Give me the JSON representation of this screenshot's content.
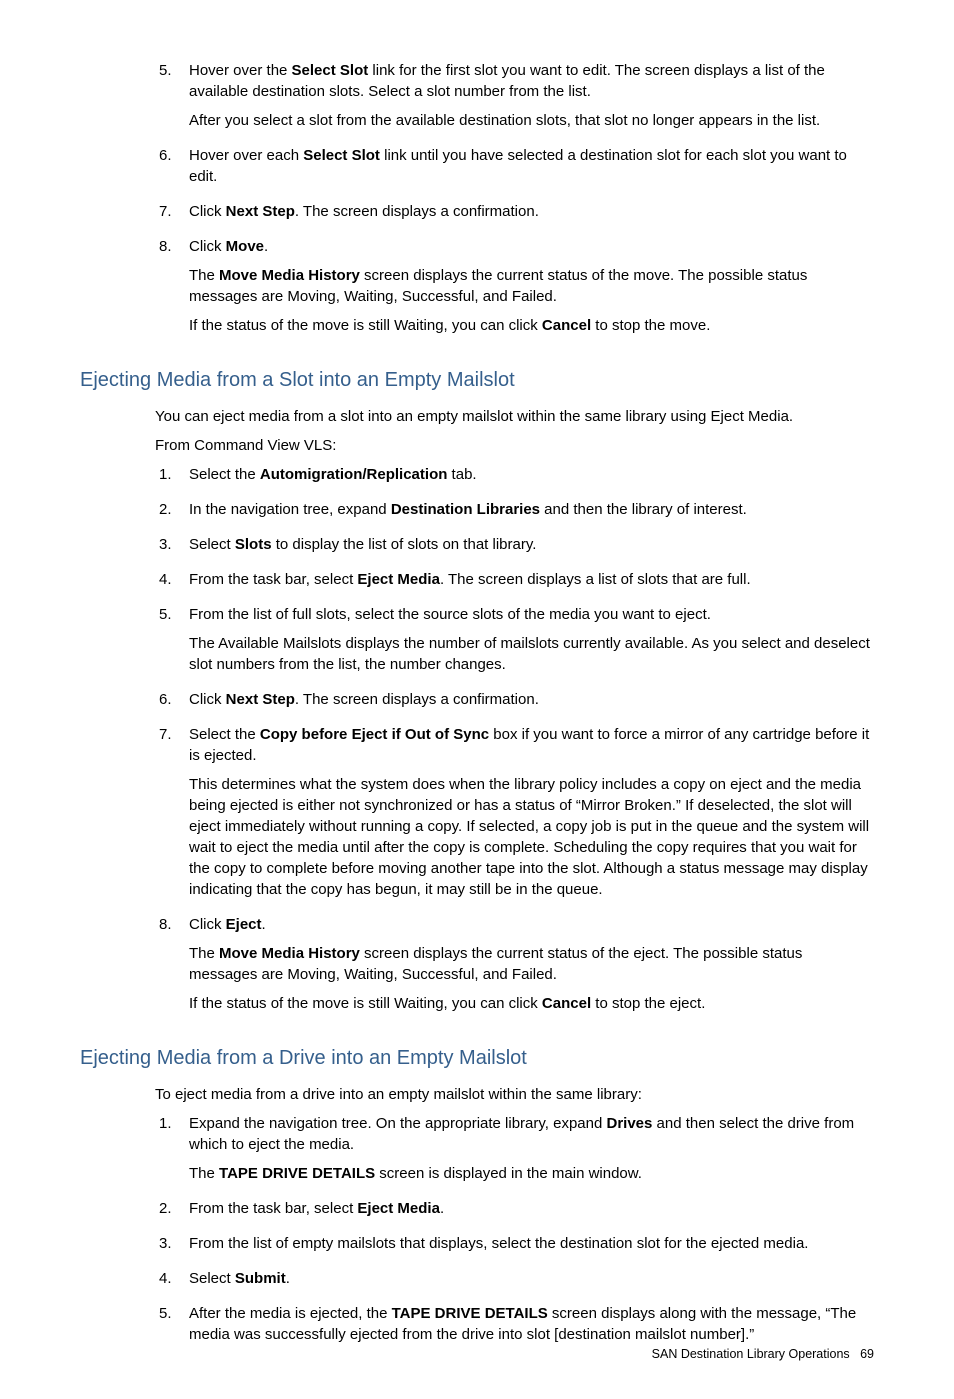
{
  "s0": {
    "items": [
      {
        "num": "5.",
        "paras": [
          [
            {
              "t": "Hover over the "
            },
            {
              "t": "Select Slot",
              "b": true
            },
            {
              "t": " link for the first slot you want to edit. The screen displays a list of the available destination slots. Select a slot number from the list."
            }
          ],
          [
            {
              "t": "After you select a slot from the available destination slots, that slot no longer appears in the list."
            }
          ]
        ]
      },
      {
        "num": "6.",
        "paras": [
          [
            {
              "t": "Hover over each "
            },
            {
              "t": "Select Slot",
              "b": true
            },
            {
              "t": " link until you have selected a destination slot for each slot you want to edit."
            }
          ]
        ]
      },
      {
        "num": "7.",
        "paras": [
          [
            {
              "t": "Click "
            },
            {
              "t": "Next Step",
              "b": true
            },
            {
              "t": ". The screen displays a confirmation."
            }
          ]
        ]
      },
      {
        "num": "8.",
        "paras": [
          [
            {
              "t": "Click "
            },
            {
              "t": "Move",
              "b": true
            },
            {
              "t": "."
            }
          ],
          [
            {
              "t": "The "
            },
            {
              "t": "Move Media History",
              "b": true
            },
            {
              "t": " screen displays the current status of the move. The possible status messages are Moving, Waiting, Successful, and Failed."
            }
          ],
          [
            {
              "t": "If the status of the move is still Waiting, you can click "
            },
            {
              "t": "Cancel",
              "b": true
            },
            {
              "t": " to stop the move."
            }
          ]
        ]
      }
    ]
  },
  "s1": {
    "heading": "Ejecting Media from a Slot into an Empty Mailslot",
    "intro": [
      "You can eject media from a slot into an empty mailslot within the same library using Eject Media.",
      "From Command View VLS:"
    ],
    "items": [
      {
        "num": "1.",
        "paras": [
          [
            {
              "t": "Select the "
            },
            {
              "t": "Automigration/Replication",
              "b": true
            },
            {
              "t": " tab."
            }
          ]
        ]
      },
      {
        "num": "2.",
        "paras": [
          [
            {
              "t": "In the navigation tree, expand "
            },
            {
              "t": "Destination Libraries",
              "b": true
            },
            {
              "t": " and then the library of interest."
            }
          ]
        ]
      },
      {
        "num": "3.",
        "paras": [
          [
            {
              "t": "Select "
            },
            {
              "t": "Slots",
              "b": true
            },
            {
              "t": " to display the list of slots on that library."
            }
          ]
        ]
      },
      {
        "num": "4.",
        "paras": [
          [
            {
              "t": "From the task bar, select "
            },
            {
              "t": "Eject Media",
              "b": true
            },
            {
              "t": ". The screen displays a list of slots that are full."
            }
          ]
        ]
      },
      {
        "num": "5.",
        "paras": [
          [
            {
              "t": "From the list of full slots, select the source slots of the media you want to eject."
            }
          ],
          [
            {
              "t": "The Available Mailslots displays the number of mailslots currently available. As you select and deselect slot numbers from the list, the number changes."
            }
          ]
        ]
      },
      {
        "num": "6.",
        "paras": [
          [
            {
              "t": "Click "
            },
            {
              "t": "Next Step",
              "b": true
            },
            {
              "t": ". The screen displays a confirmation."
            }
          ]
        ]
      },
      {
        "num": "7.",
        "paras": [
          [
            {
              "t": "Select the "
            },
            {
              "t": "Copy before Eject if Out of Sync",
              "b": true
            },
            {
              "t": " box if you want to force a mirror of any cartridge before it is ejected."
            }
          ],
          [
            {
              "t": "This determines what the system does when the library policy includes a copy on eject and the media being ejected is either not synchronized or has a status of “Mirror Broken.” If deselected, the slot will eject immediately without running a copy. If selected, a copy job is put in the queue and the system will wait to eject the media until after the copy is complete. Scheduling the copy requires that you wait for the copy to complete before moving another tape into the slot. Although a status message may display indicating that the copy has begun, it may still be in the queue."
            }
          ]
        ]
      },
      {
        "num": "8.",
        "paras": [
          [
            {
              "t": "Click "
            },
            {
              "t": "Eject",
              "b": true
            },
            {
              "t": "."
            }
          ],
          [
            {
              "t": "The "
            },
            {
              "t": "Move Media History",
              "b": true
            },
            {
              "t": " screen displays the current status of the eject. The possible status messages are Moving, Waiting, Successful, and Failed."
            }
          ],
          [
            {
              "t": "If the status of the move is still Waiting, you can click "
            },
            {
              "t": "Cancel",
              "b": true
            },
            {
              "t": " to stop the eject."
            }
          ]
        ]
      }
    ]
  },
  "s2": {
    "heading": "Ejecting Media from a Drive into an Empty Mailslot",
    "intro": [
      "To eject media from a drive into an empty mailslot within the same library:"
    ],
    "items": [
      {
        "num": "1.",
        "paras": [
          [
            {
              "t": "Expand the navigation tree. On the appropriate library, expand "
            },
            {
              "t": "Drives",
              "b": true
            },
            {
              "t": " and then select the drive from which to eject the media."
            }
          ],
          [
            {
              "t": "The "
            },
            {
              "t": "TAPE DRIVE DETAILS",
              "b": true
            },
            {
              "t": " screen is displayed in the main window."
            }
          ]
        ]
      },
      {
        "num": "2.",
        "paras": [
          [
            {
              "t": "From the task bar, select "
            },
            {
              "t": "Eject Media",
              "b": true
            },
            {
              "t": "."
            }
          ]
        ]
      },
      {
        "num": "3.",
        "paras": [
          [
            {
              "t": "From the list of empty mailslots that displays, select the destination slot for the ejected media."
            }
          ]
        ]
      },
      {
        "num": "4.",
        "paras": [
          [
            {
              "t": "Select "
            },
            {
              "t": "Submit",
              "b": true
            },
            {
              "t": "."
            }
          ]
        ]
      },
      {
        "num": "5.",
        "paras": [
          [
            {
              "t": "After the media is ejected, the "
            },
            {
              "t": "TAPE DRIVE DETAILS",
              "b": true
            },
            {
              "t": " screen displays along with the message, “The media was successfully ejected from the drive into slot [destination mailslot number].”"
            }
          ]
        ]
      }
    ]
  },
  "footer": {
    "text": "SAN Destination Library Operations",
    "page": "69"
  }
}
